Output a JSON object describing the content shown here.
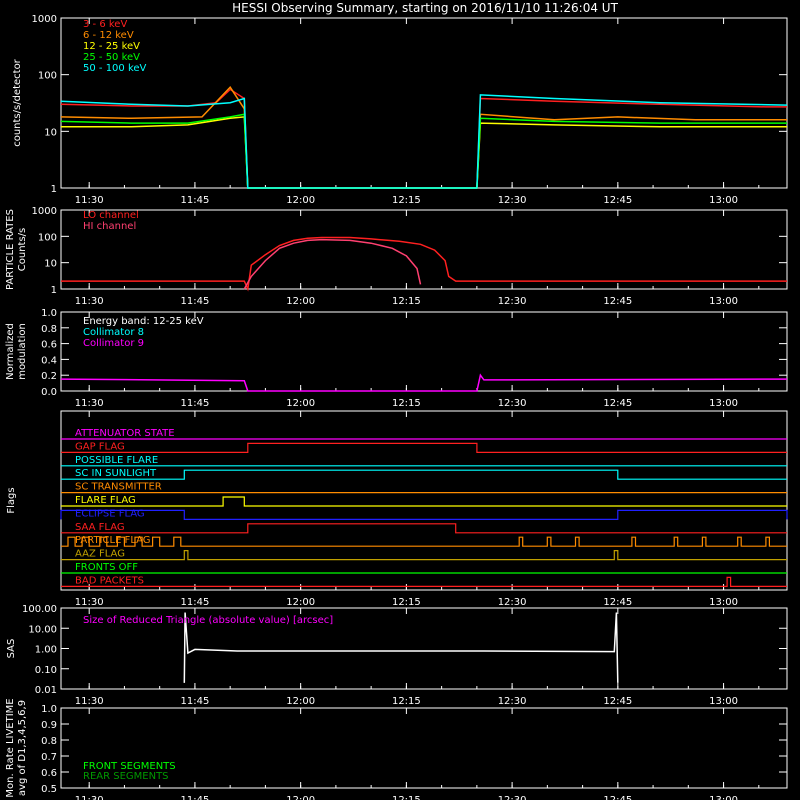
{
  "chart_data": {
    "type": "line",
    "title": "HESSI Observing Summary, starting on 2016/11/10 11:26:04 UT",
    "time_range_min": [
      0,
      237
    ],
    "x_ticks": [
      {
        "t": 4,
        "label": "11:30"
      },
      {
        "t": 19,
        "label": "11:45"
      },
      {
        "t": 34,
        "label": "12:00"
      },
      {
        "t": 49,
        "label": "12:15"
      },
      {
        "t": 64,
        "label": "12:30"
      },
      {
        "t": 79,
        "label": "12:45"
      },
      {
        "t": 94,
        "label": "13:00"
      }
    ],
    "panels": [
      {
        "id": "count-rates",
        "ylabel": "counts/s/detector",
        "scale": "log",
        "ylim": [
          1,
          1000
        ],
        "y_ticks": [
          "1",
          "10",
          "100",
          "1000"
        ],
        "legend": [
          {
            "name": "3 - 6 keV",
            "color": "#ff2020"
          },
          {
            "name": "6 - 12 keV",
            "color": "#ff8c00"
          },
          {
            "name": "12 - 25 keV",
            "color": "#ffff00"
          },
          {
            "name": "25 - 50 keV",
            "color": "#00ff00"
          },
          {
            "name": "50 - 100 keV",
            "color": "#00ffff"
          }
        ],
        "series": [
          {
            "name": "3 - 6 keV",
            "color": "#ff2020",
            "points": [
              [
                0,
                30
              ],
              [
                10,
                28
              ],
              [
                18,
                28
              ],
              [
                22,
                32
              ],
              [
                24,
                55
              ],
              [
                26,
                38
              ],
              [
                26.5,
                1
              ],
              [
                59,
                1
              ],
              [
                59.5,
                38
              ],
              [
                70,
                34
              ],
              [
                85,
                30
              ],
              [
                100,
                27
              ],
              [
                103,
                27
              ]
            ]
          },
          {
            "name": "6 - 12 keV",
            "color": "#ff8c00",
            "points": [
              [
                0,
                18
              ],
              [
                10,
                17
              ],
              [
                20,
                18
              ],
              [
                24,
                60
              ],
              [
                26,
                25
              ],
              [
                26.5,
                1
              ],
              [
                59,
                1
              ],
              [
                59.5,
                20
              ],
              [
                70,
                16
              ],
              [
                79,
                18
              ],
              [
                90,
                16
              ],
              [
                103,
                16
              ]
            ]
          },
          {
            "name": "12 - 25 keV",
            "color": "#ffff00",
            "points": [
              [
                0,
                12
              ],
              [
                10,
                12
              ],
              [
                18,
                13
              ],
              [
                24,
                17
              ],
              [
                26,
                18
              ],
              [
                26.5,
                1
              ],
              [
                59,
                1
              ],
              [
                59.5,
                14
              ],
              [
                70,
                13
              ],
              [
                85,
                12
              ],
              [
                103,
                12
              ]
            ]
          },
          {
            "name": "25 - 50 keV",
            "color": "#00ff00",
            "points": [
              [
                0,
                15
              ],
              [
                10,
                14
              ],
              [
                18,
                14
              ],
              [
                24,
                18
              ],
              [
                26,
                20
              ],
              [
                26.5,
                1
              ],
              [
                59,
                1
              ],
              [
                59.5,
                17
              ],
              [
                70,
                15
              ],
              [
                85,
                14
              ],
              [
                103,
                14
              ]
            ]
          },
          {
            "name": "50 - 100 keV",
            "color": "#00ffff",
            "points": [
              [
                0,
                34
              ],
              [
                10,
                30
              ],
              [
                18,
                28
              ],
              [
                24,
                32
              ],
              [
                26,
                38
              ],
              [
                26.5,
                1
              ],
              [
                59,
                1
              ],
              [
                59.5,
                44
              ],
              [
                70,
                38
              ],
              [
                85,
                32
              ],
              [
                103,
                29
              ]
            ]
          }
        ]
      },
      {
        "id": "particle-rates",
        "ylabel": "PARTICLE RATES",
        "ylabel2": "Counts/s",
        "scale": "log",
        "ylim": [
          1,
          1000
        ],
        "y_ticks": [
          "1",
          "10",
          "100",
          "1000"
        ],
        "legend": [
          {
            "name": "LO channel",
            "color": "#ff2020"
          },
          {
            "name": "HI channel",
            "color": "#ff4070"
          }
        ],
        "series": [
          {
            "name": "LO channel",
            "color": "#ff2020",
            "points": [
              [
                0,
                2
              ],
              [
                26,
                2
              ],
              [
                26.5,
                1
              ],
              [
                27,
                8
              ],
              [
                29,
                20
              ],
              [
                31,
                45
              ],
              [
                33,
                70
              ],
              [
                35,
                85
              ],
              [
                37,
                90
              ],
              [
                41,
                90
              ],
              [
                44,
                80
              ],
              [
                48,
                65
              ],
              [
                51,
                50
              ],
              [
                53,
                30
              ],
              [
                54.5,
                12
              ],
              [
                55,
                3
              ],
              [
                56,
                2
              ],
              [
                103,
                2
              ]
            ]
          },
          {
            "name": "HI channel",
            "color": "#ff4070",
            "points": [
              [
                26,
                1
              ],
              [
                27,
                3
              ],
              [
                29,
                12
              ],
              [
                31,
                35
              ],
              [
                33,
                55
              ],
              [
                35,
                70
              ],
              [
                37,
                75
              ],
              [
                41,
                70
              ],
              [
                44,
                55
              ],
              [
                47,
                35
              ],
              [
                49,
                18
              ],
              [
                50.5,
                6
              ],
              [
                51,
                1.5
              ]
            ]
          }
        ]
      },
      {
        "id": "modulation",
        "ylabel": "Normalized",
        "ylabel2": "modulation",
        "scale": "linear",
        "ylim": [
          0,
          1
        ],
        "y_ticks": [
          "0.0",
          "0.2",
          "0.4",
          "0.6",
          "0.8",
          "1.0"
        ],
        "legend": [
          {
            "name": "Energy band: 12-25 keV",
            "color": "#ffffff"
          },
          {
            "name": "Collimator 8",
            "color": "#00ffff"
          },
          {
            "name": "Collimator 9",
            "color": "#ff00ff"
          }
        ],
        "series": [
          {
            "name": "Collimator 9",
            "color": "#ff00ff",
            "points": [
              [
                0,
                0.15
              ],
              [
                26,
                0.13
              ],
              [
                26.5,
                0
              ],
              [
                59,
                0
              ],
              [
                59.5,
                0.2
              ],
              [
                60,
                0.14
              ],
              [
                103,
                0.15
              ]
            ]
          }
        ]
      },
      {
        "id": "flags",
        "ylabel": "Flags",
        "flags": [
          {
            "name": "ATTENUATOR STATE",
            "color": "#ff00ff",
            "on": []
          },
          {
            "name": "GAP FLAG",
            "color": "#ff2020",
            "on": [
              [
                26.5,
                59
              ]
            ]
          },
          {
            "name": "POSSIBLE FLARE",
            "color": "#00ffff",
            "on": []
          },
          {
            "name": "SC IN SUNLIGHT",
            "color": "#00ffff",
            "on": [
              [
                17.5,
                79
              ]
            ]
          },
          {
            "name": "SC TRANSMITTER",
            "color": "#ff8c00",
            "on": []
          },
          {
            "name": "FLARE FLAG",
            "color": "#ffff00",
            "on": [
              [
                23,
                26
              ]
            ]
          },
          {
            "name": "ECLIPSE FLAG",
            "color": "#2020ff",
            "on": [
              [
                0,
                17.5
              ],
              [
                79,
                103
              ]
            ]
          },
          {
            "name": "SAA FLAG",
            "color": "#ff2020",
            "on": [
              [
                26.5,
                56
              ]
            ]
          },
          {
            "name": "PARTICLE FLAG",
            "color": "#ff8c00",
            "on": [
              [
                1,
                2
              ],
              [
                3,
                4
              ],
              [
                5.5,
                6.5
              ],
              [
                8,
                9
              ],
              [
                10.5,
                11.5
              ],
              [
                13,
                14
              ],
              [
                16,
                17
              ],
              [
                65,
                65.5
              ],
              [
                69,
                69.5
              ],
              [
                73,
                73.5
              ],
              [
                81,
                81.5
              ],
              [
                87,
                87.5
              ],
              [
                91,
                91.5
              ],
              [
                96,
                96.5
              ],
              [
                100,
                100.5
              ]
            ]
          },
          {
            "name": "AAZ FLAG",
            "color": "#c0a000",
            "on": [
              [
                17.5,
                18
              ],
              [
                78.5,
                79
              ]
            ]
          },
          {
            "name": "FRONTS OFF",
            "color": "#00ff00",
            "on": []
          },
          {
            "name": "BAD PACKETS",
            "color": "#ff2020",
            "on": [
              [
                94.5,
                95
              ]
            ]
          }
        ]
      },
      {
        "id": "sas",
        "ylabel": "SAS",
        "scale": "log",
        "ylim": [
          0.01,
          100
        ],
        "y_ticks": [
          "0.01",
          "0.10",
          "1.00",
          "10.00",
          "100.00"
        ],
        "legend": [
          {
            "name": "Size of Reduced Triangle (absolute value) [arcsec]",
            "color": "#ff00ff"
          }
        ],
        "series": [
          {
            "name": "Size of Reduced Triangle",
            "color": "#ffffff",
            "points": [
              [
                17.5,
                0.02
              ],
              [
                17.6,
                60
              ],
              [
                18,
                0.6
              ],
              [
                19,
                0.9
              ],
              [
                25,
                0.75
              ],
              [
                40,
                0.75
              ],
              [
                60,
                0.75
              ],
              [
                78.5,
                0.7
              ],
              [
                78.8,
                60
              ],
              [
                79,
                0.02
              ]
            ]
          }
        ]
      },
      {
        "id": "monitor-rate",
        "ylabel": "Mon. Rate LIVETIME",
        "ylabel2": "avg of D1,3,4,5,6,9",
        "scale": "linear",
        "ylim": [
          0.5,
          1.0
        ],
        "y_ticks": [
          "0.5",
          "0.6",
          "0.7",
          "0.8",
          "0.9",
          "1.0"
        ],
        "legend": [
          {
            "name": "FRONT SEGMENTS",
            "color": "#00ff00"
          },
          {
            "name": "REAR SEGMENTS",
            "color": "#009900"
          }
        ],
        "series": []
      }
    ]
  }
}
